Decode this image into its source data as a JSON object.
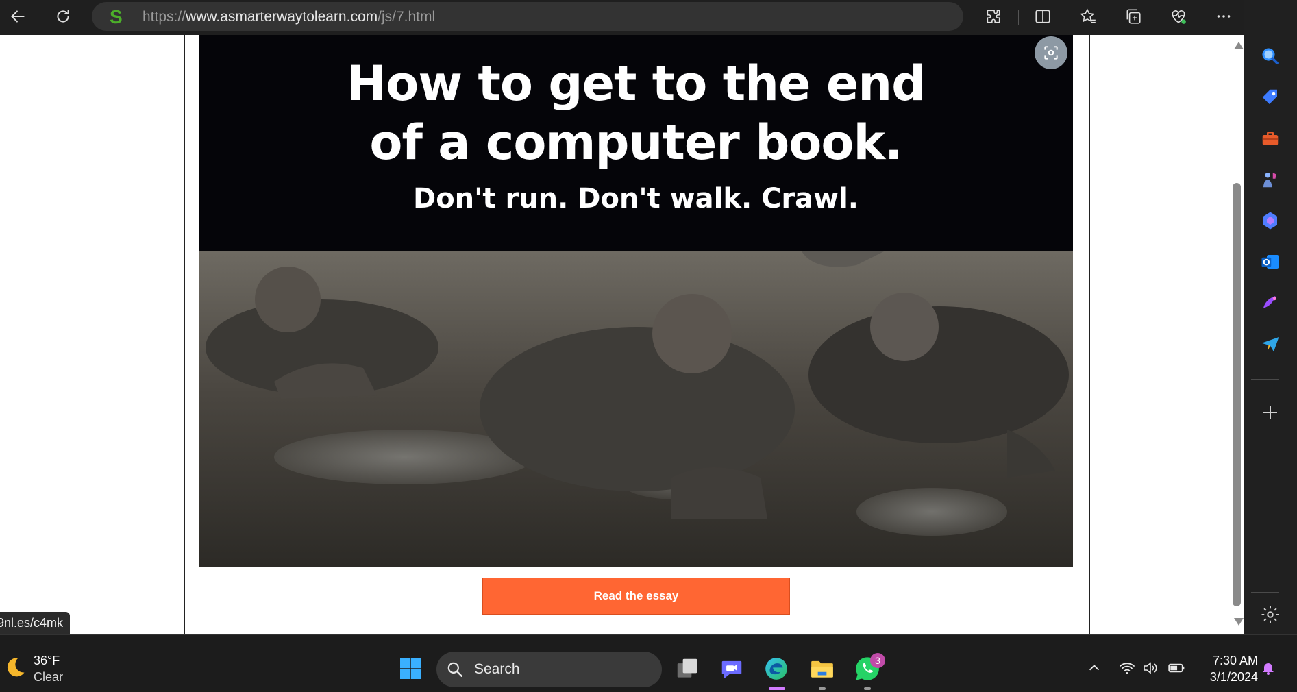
{
  "browser": {
    "url_protocol": "https://",
    "url_host": "www.asmarterwaytolearn.com",
    "url_path": "/js/7.html",
    "icons": [
      "back-icon",
      "refresh-icon",
      "site-favicon",
      "extensions-icon",
      "split-screen-icon",
      "favorites-icon",
      "collections-icon",
      "browser-essentials-icon",
      "more-icon",
      "copilot-icon"
    ]
  },
  "page": {
    "promo_headline_line1": "How to get to the end",
    "promo_headline_line2": "of a computer book.",
    "promo_subheadline": "Don't run. Don't walk. Crawl.",
    "read_essay_label": "Read the essay",
    "status_url": "9nl.es/c4mk"
  },
  "sidebar": {
    "items": [
      "search-icon",
      "shopping-tag-icon",
      "tools-icon",
      "games-icon",
      "copilot-icon",
      "outlook-icon",
      "designer-icon",
      "telegram-icon",
      "add-icon",
      "settings-icon"
    ]
  },
  "taskbar": {
    "weather_temp": "36°F",
    "weather_condition": "Clear",
    "search_label": "Search",
    "whatsapp_badge": "3",
    "time": "7:30 AM",
    "date": "3/1/2024"
  },
  "colors": {
    "button_orange": "#ff6633",
    "browser_chrome": "#1f1f1f",
    "taskbar": "#1c1c1c"
  }
}
